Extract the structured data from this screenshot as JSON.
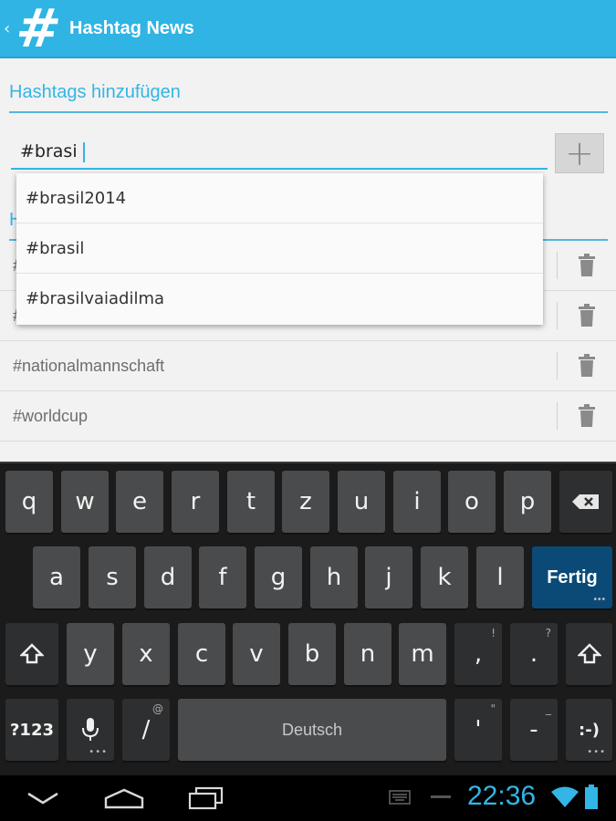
{
  "app": {
    "title": "Hashtag News",
    "logo_glyph": "#",
    "up_glyph": "‹"
  },
  "form": {
    "section_header": "Hashtags hinzufügen",
    "input_value": "#brasi",
    "add_glyph": "+"
  },
  "list": {
    "header": "H",
    "items": [
      {
        "label": "#"
      },
      {
        "label": "#"
      },
      {
        "label": "#nationalmannschaft"
      },
      {
        "label": "#worldcup"
      }
    ]
  },
  "suggestions": [
    {
      "label": "#brasil2014"
    },
    {
      "label": "#brasil"
    },
    {
      "label": "#brasilvaiadilma"
    }
  ],
  "keyboard": {
    "row1": [
      "q",
      "w",
      "e",
      "r",
      "t",
      "z",
      "u",
      "i",
      "o",
      "p"
    ],
    "row2": [
      "a",
      "s",
      "d",
      "f",
      "g",
      "h",
      "j",
      "k",
      "l"
    ],
    "row3": [
      "y",
      "x",
      "c",
      "v",
      "b",
      "n",
      "m"
    ],
    "row3_punct": [
      ",",
      "."
    ],
    "row3_hints": [
      "!",
      "?"
    ],
    "action_label": "Fertig",
    "symbols_label": "?123",
    "slash_label": "/",
    "slash_hint": "@",
    "space_label": "Deutsch",
    "apostrophe_label": "'",
    "apostrophe_hint": "\"",
    "dash_label": "-",
    "dash_hint": "_",
    "smiley_label": ":-)"
  },
  "status": {
    "time": "22:36"
  },
  "colors": {
    "accent": "#33b5e5",
    "action_bar": "#2fb4e3",
    "action_key": "#0b4a77"
  }
}
